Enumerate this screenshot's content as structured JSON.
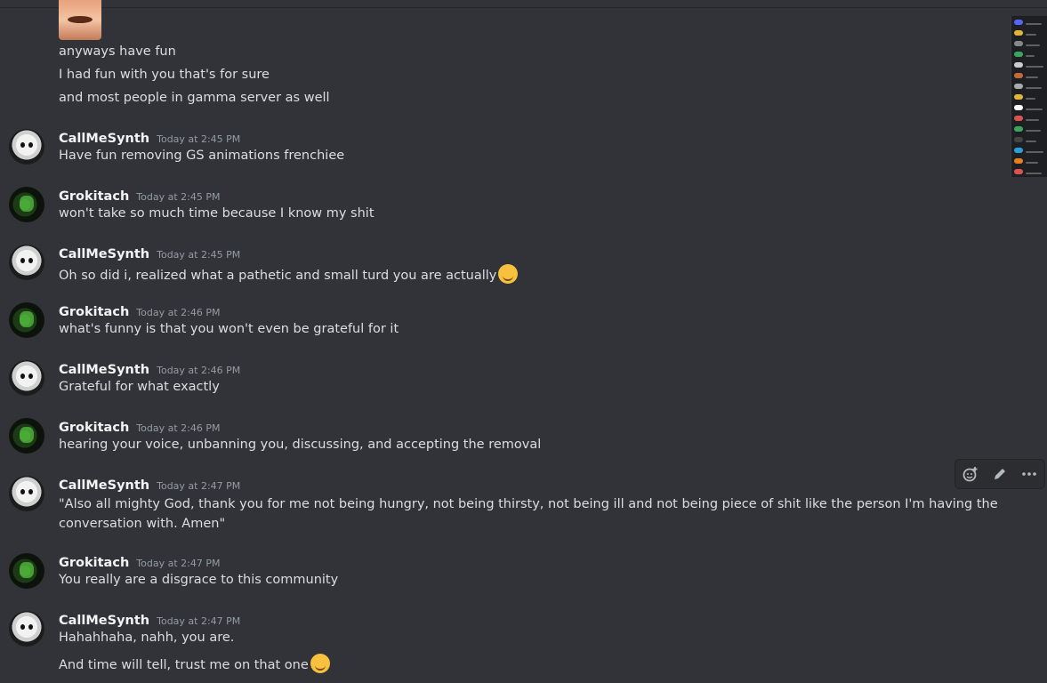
{
  "messages_top": [
    "anyways have fun",
    "I had fun with you that's for sure",
    "and most people in gamma server as well"
  ],
  "groups": [
    {
      "user": "CallMeSynth",
      "time": "Today at 2:45 PM",
      "avatar": "synth",
      "lines": [
        "Have fun removing GS animations frenchiee"
      ]
    },
    {
      "user": "Grokitach",
      "time": "Today at 2:45 PM",
      "avatar": "grok",
      "lines": [
        "won't take so much time because I know my shit"
      ]
    },
    {
      "user": "CallMeSynth",
      "time": "Today at 2:45 PM",
      "avatar": "synth",
      "lines": [
        "Oh so did i, realized what a pathetic and small turd you are actually"
      ],
      "emoji": "grinning-emoji"
    },
    {
      "user": "Grokitach",
      "time": "Today at 2:46 PM",
      "avatar": "grok",
      "lines": [
        "what's funny is that you won't even be grateful for it"
      ]
    },
    {
      "user": "CallMeSynth",
      "time": "Today at 2:46 PM",
      "avatar": "synth",
      "lines": [
        "Grateful for what exactly"
      ]
    },
    {
      "user": "Grokitach",
      "time": "Today at 2:46 PM",
      "avatar": "grok",
      "lines": [
        "hearing your voice, unbanning you, discussing, and accepting the removal"
      ]
    },
    {
      "user": "CallMeSynth",
      "time": "Today at 2:47 PM",
      "avatar": "synth",
      "lines": [
        "\"Also all mighty God, thank you for me not being hungry, not being thirsty, not being ill and not being piece of shit like the person I'm having the conversation with. Amen\""
      ]
    },
    {
      "user": "Grokitach",
      "time": "Today at 2:47 PM",
      "avatar": "grok",
      "lines": [
        "You really are a disgrace to this community"
      ]
    },
    {
      "user": "CallMeSynth",
      "time": "Today at 2:47 PM",
      "avatar": "synth",
      "lines": [
        "Hahahhaha, nahh, you are.",
        "And time will tell, trust me on that one"
      ],
      "emoji": "winking-emoji"
    }
  ],
  "toolbar": {
    "add_reaction_icon": "add-reaction-icon",
    "edit_icon": "pencil-icon",
    "more_icon": "more-icon"
  },
  "colors": {
    "background": "#313338",
    "username": "#f2f3f5",
    "timestamp": "#949ba4",
    "message_text": "#dbdee1"
  }
}
